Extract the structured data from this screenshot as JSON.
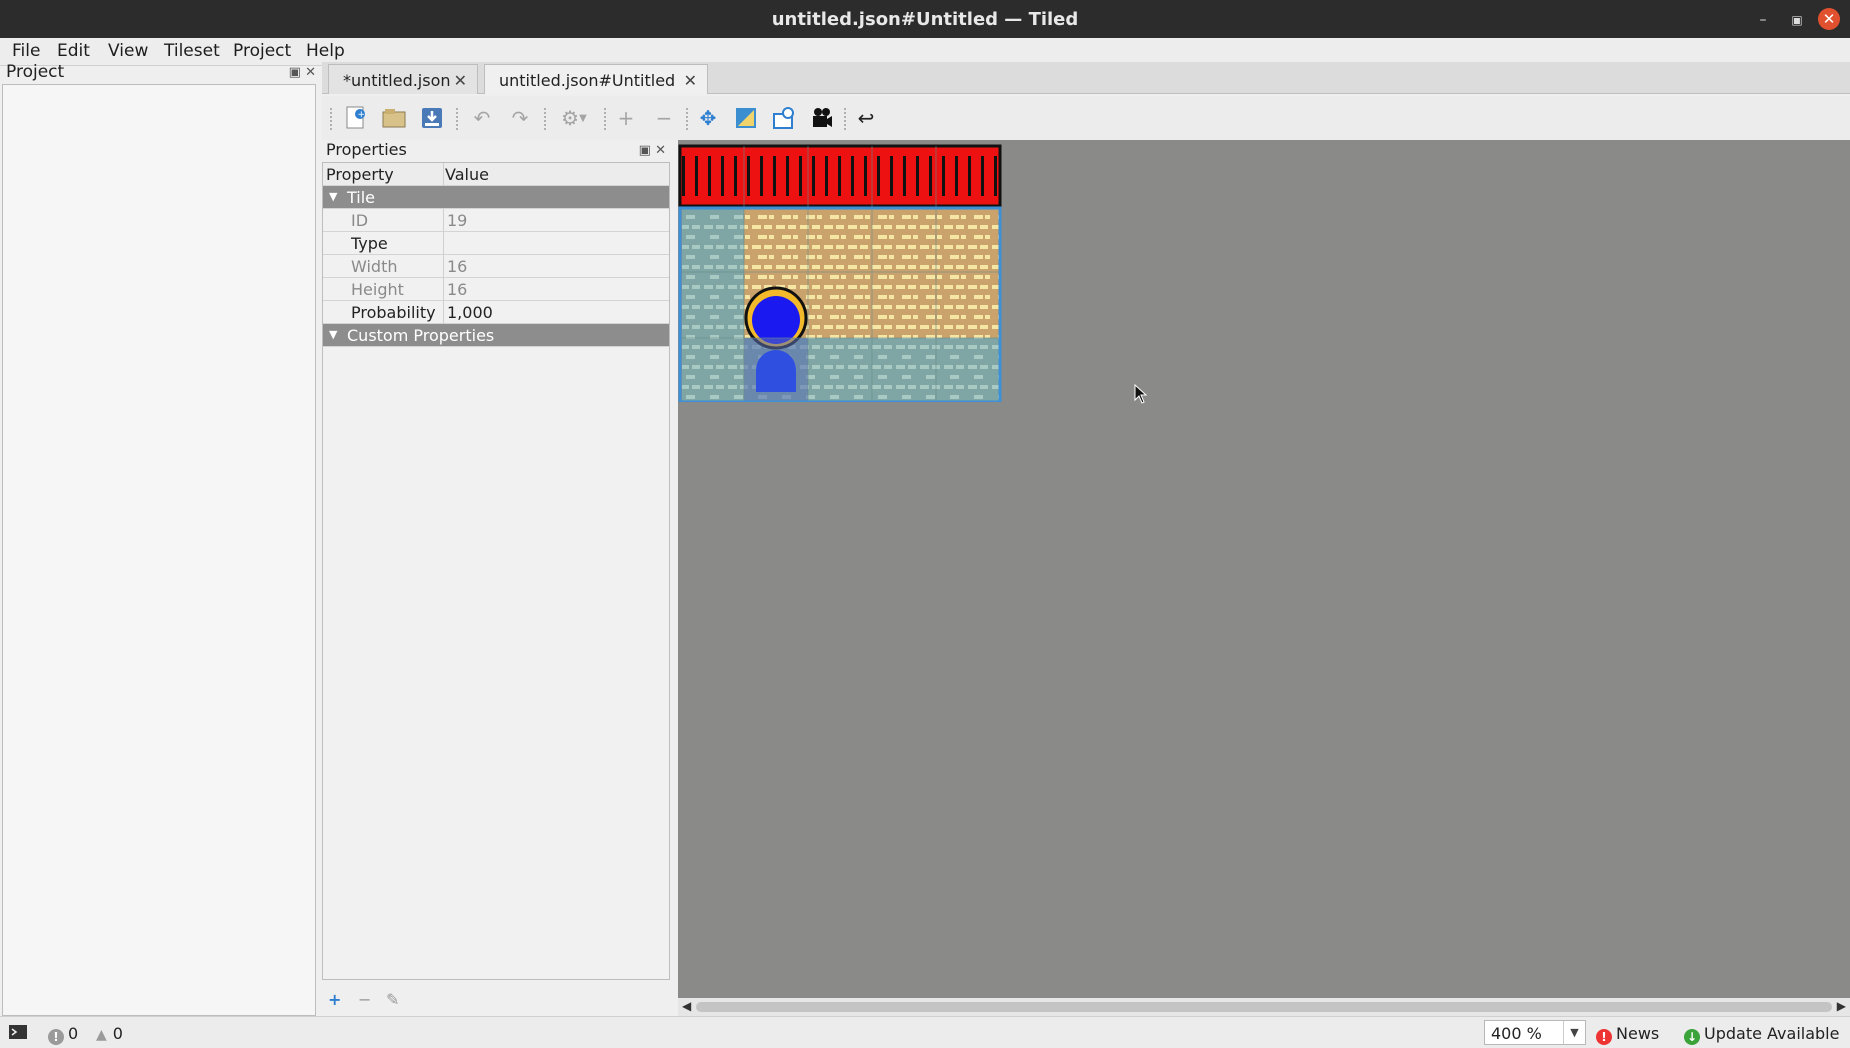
{
  "window": {
    "title": "untitled.json#Untitled — Tiled",
    "controls": [
      "minimize",
      "maximize",
      "close"
    ]
  },
  "menubar": {
    "items": [
      "File",
      "Edit",
      "View",
      "Tileset",
      "Project",
      "Help"
    ]
  },
  "project_panel": {
    "title": "Project"
  },
  "tabs": [
    {
      "label": "*untitled.json",
      "active": false
    },
    {
      "label": "untitled.json#Untitled",
      "active": true
    }
  ],
  "toolbar": {
    "icons": [
      "new-tileset-icon",
      "open-icon",
      "save-icon",
      "undo-icon",
      "redo-icon",
      "settings-icon",
      "add-icon",
      "remove-icon",
      "move-icon",
      "edit-terrain-icon",
      "edit-collision-icon",
      "animation-editor-icon",
      "back-icon"
    ]
  },
  "properties": {
    "title": "Properties",
    "header": {
      "property": "Property",
      "value": "Value"
    },
    "tile_group": "Tile",
    "rows": [
      {
        "name": "ID",
        "value": "19",
        "enabled": false
      },
      {
        "name": "Type",
        "value": "",
        "enabled": true
      },
      {
        "name": "Width",
        "value": "16",
        "enabled": false
      },
      {
        "name": "Height",
        "value": "16",
        "enabled": false
      },
      {
        "name": "Probability",
        "value": "1,000",
        "enabled": true
      }
    ],
    "custom_group": "Custom Properties"
  },
  "statusbar": {
    "errors": "0",
    "warnings": "0",
    "zoom": "400 %",
    "news": "News",
    "update": "Update Available"
  },
  "colors": {
    "titlebar": "#2c2c2c",
    "close_button": "#e2512f",
    "canvas_bg": "#8a8b89",
    "group_row": "#8d8d8d",
    "tile_red": "#ee1111",
    "tile_sand": "#c9a36b",
    "tile_stone": "#7fa6a4",
    "selection": "#3d8fd6"
  }
}
